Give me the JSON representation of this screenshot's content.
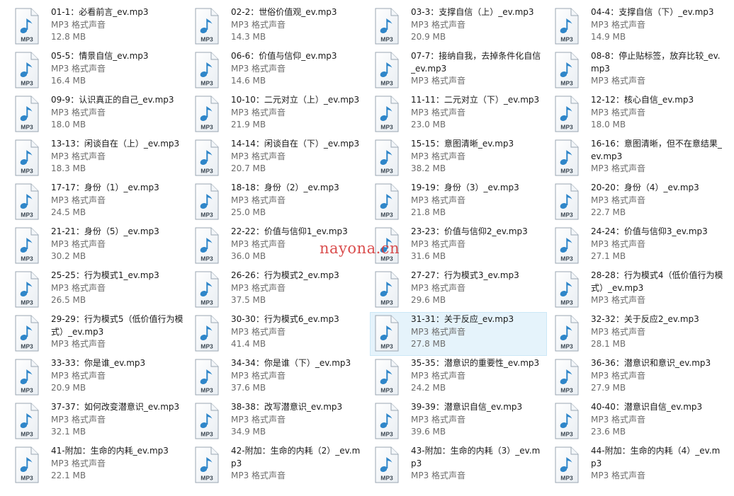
{
  "file_type_label": "MP3 格式声音",
  "icon": {
    "name": "mp3-audio-file-icon",
    "badge_text": "MP3",
    "note_color": "#2f86c9"
  },
  "watermark": "nayona.cn",
  "selected_index": 30,
  "files": [
    {
      "name": "01-1：必看前言_ev.mp3",
      "size": "12.8 MB"
    },
    {
      "name": "02-2：世俗价值观_ev.mp3",
      "size": "14.3 MB"
    },
    {
      "name": "03-3：支撑自信（上）_ev.mp3",
      "size": "20.9 MB"
    },
    {
      "name": "04-4：支撑自信（下）_ev.mp3",
      "size": "14.9 MB"
    },
    {
      "name": "05-5：情景自信_ev.mp3",
      "size": "16.4 MB"
    },
    {
      "name": "06-6：价值与信仰_ev.mp3",
      "size": "14.6 MB"
    },
    {
      "name": "07-7：接纳自我，去掉条件化自信_ev.mp3",
      "size": ""
    },
    {
      "name": "08-8：停止贴标签，放弃比较_ev.mp3",
      "size": ""
    },
    {
      "name": "09-9：认识真正的自己_ev.mp3",
      "size": "18.0 MB"
    },
    {
      "name": "10-10：二元对立（上）_ev.mp3",
      "size": "21.9 MB"
    },
    {
      "name": "11-11：二元对立（下）_ev.mp3",
      "size": "23.0 MB"
    },
    {
      "name": "12-12：核心自信_ev.mp3",
      "size": "18.0 MB"
    },
    {
      "name": "13-13：闲谈自在（上）_ev.mp3",
      "size": "18.3 MB"
    },
    {
      "name": "14-14：闲谈自在（下）_ev.mp3",
      "size": "20.7 MB"
    },
    {
      "name": "15-15：意图清晰_ev.mp3",
      "size": "38.2 MB"
    },
    {
      "name": "16-16：意图清晰，但不在意结果_ev.mp3",
      "size": ""
    },
    {
      "name": "17-17：身份（1）_ev.mp3",
      "size": "24.5 MB"
    },
    {
      "name": "18-18：身份（2）_ev.mp3",
      "size": "25.0 MB"
    },
    {
      "name": "19-19：身份（3）_ev.mp3",
      "size": "21.8 MB"
    },
    {
      "name": "20-20：身份（4）_ev.mp3",
      "size": "22.7 MB"
    },
    {
      "name": "21-21：身份（5）_ev.mp3",
      "size": "30.2 MB"
    },
    {
      "name": "22-22：价值与信仰1_ev.mp3",
      "size": "36.0 MB"
    },
    {
      "name": "23-23：价值与信仰2_ev.mp3",
      "size": "31.6 MB"
    },
    {
      "name": "24-24：价值与信仰3_ev.mp3",
      "size": "27.1 MB"
    },
    {
      "name": "25-25：行为模式1_ev.mp3",
      "size": "26.5 MB"
    },
    {
      "name": "26-26：行为模式2_ev.mp3",
      "size": "37.5 MB"
    },
    {
      "name": "27-27：行为模式3_ev.mp3",
      "size": "29.6 MB"
    },
    {
      "name": "28-28：行为模式4（低价值行为模式）_ev.mp3",
      "size": ""
    },
    {
      "name": "29-29：行为模式5（低价值行为模式）_ev.mp3",
      "size": ""
    },
    {
      "name": "30-30：行为模式6_ev.mp3",
      "size": "41.4 MB"
    },
    {
      "name": "31-31：关于反应_ev.mp3",
      "size": "27.8 MB"
    },
    {
      "name": "32-32：关于反应2_ev.mp3",
      "size": "28.1 MB"
    },
    {
      "name": "33-33：你是谁_ev.mp3",
      "size": "20.9 MB"
    },
    {
      "name": "34-34：你是谁（下）_ev.mp3",
      "size": "37.6 MB"
    },
    {
      "name": "35-35：潜意识的重要性_ev.mp3",
      "size": "24.2 MB"
    },
    {
      "name": "36-36：潜意识和意识_ev.mp3",
      "size": "27.9 MB"
    },
    {
      "name": "37-37：如何改变潜意识_ev.mp3",
      "size": "32.1 MB"
    },
    {
      "name": "38-38：改写潜意识_ev.mp3",
      "size": "34.9 MB"
    },
    {
      "name": "39-39：潜意识自信_ev.mp3",
      "size": "39.6 MB"
    },
    {
      "name": "40-40：潜意识自信_ev.mp3",
      "size": "23.6 MB"
    },
    {
      "name": "41-附加：生命的内耗_ev.mp3",
      "size": "22.1 MB"
    },
    {
      "name": "42-附加：生命的内耗（2）_ev.mp3",
      "size": ""
    },
    {
      "name": "43-附加：生命的内耗（3）_ev.mp3",
      "size": ""
    },
    {
      "name": "44-附加：生命的内耗（4）_ev.mp3",
      "size": ""
    }
  ]
}
